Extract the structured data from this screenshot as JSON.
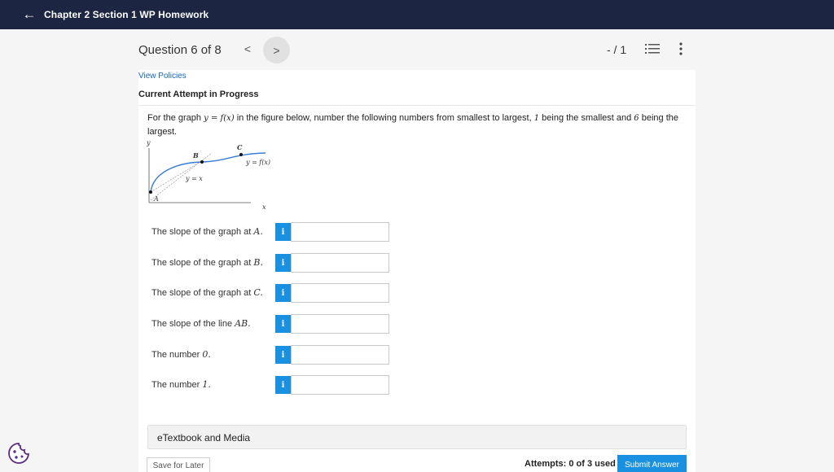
{
  "topbar": {
    "title": "Chapter 2 Section 1 WP Homework",
    "back_icon": "arrow-left-icon"
  },
  "question_header": {
    "counter": "Question 6 of 8",
    "prev_symbol": "<",
    "next_symbol": ">",
    "score": "- / 1"
  },
  "links": {
    "view_policies": "View Policies"
  },
  "status": "Current Attempt in Progress",
  "question": {
    "text_before": "For the graph",
    "math_eq": "y = f(x)",
    "text_after": "in the figure below, number the following numbers from smallest to largest,",
    "one": "1",
    "mid": "being the smallest and",
    "six": "6",
    "end": "being the largest."
  },
  "figure": {
    "y_axis": "y",
    "x_axis": "x",
    "point_a": "A",
    "point_b": "B",
    "point_c": "C",
    "curve_label": "y = f(x)",
    "line_label": "y = x",
    "curve_color": "#3a7bd5"
  },
  "rows": [
    {
      "label": "The slope of the graph at",
      "math": "A.",
      "info": "i",
      "value": ""
    },
    {
      "label": "The slope of the graph at",
      "math": "B.",
      "info": "i",
      "value": ""
    },
    {
      "label": "The slope of the graph at",
      "math": "C.",
      "info": "i",
      "value": ""
    },
    {
      "label": "The slope of the line",
      "math": "AB.",
      "info": "i",
      "value": ""
    },
    {
      "label": "The number",
      "math": "0.",
      "info": "i",
      "value": ""
    },
    {
      "label": "The number",
      "math": "1.",
      "info": "i",
      "value": ""
    }
  ],
  "etextbook": "eTextbook and Media",
  "footer": {
    "save_later": "Save for Later",
    "attempts": "Attempts: 0 of 3 used",
    "submit": "Submit Answer"
  },
  "colors": {
    "topbar": "#1c2541",
    "accent": "#1a90e0",
    "link": "#1565c0"
  }
}
